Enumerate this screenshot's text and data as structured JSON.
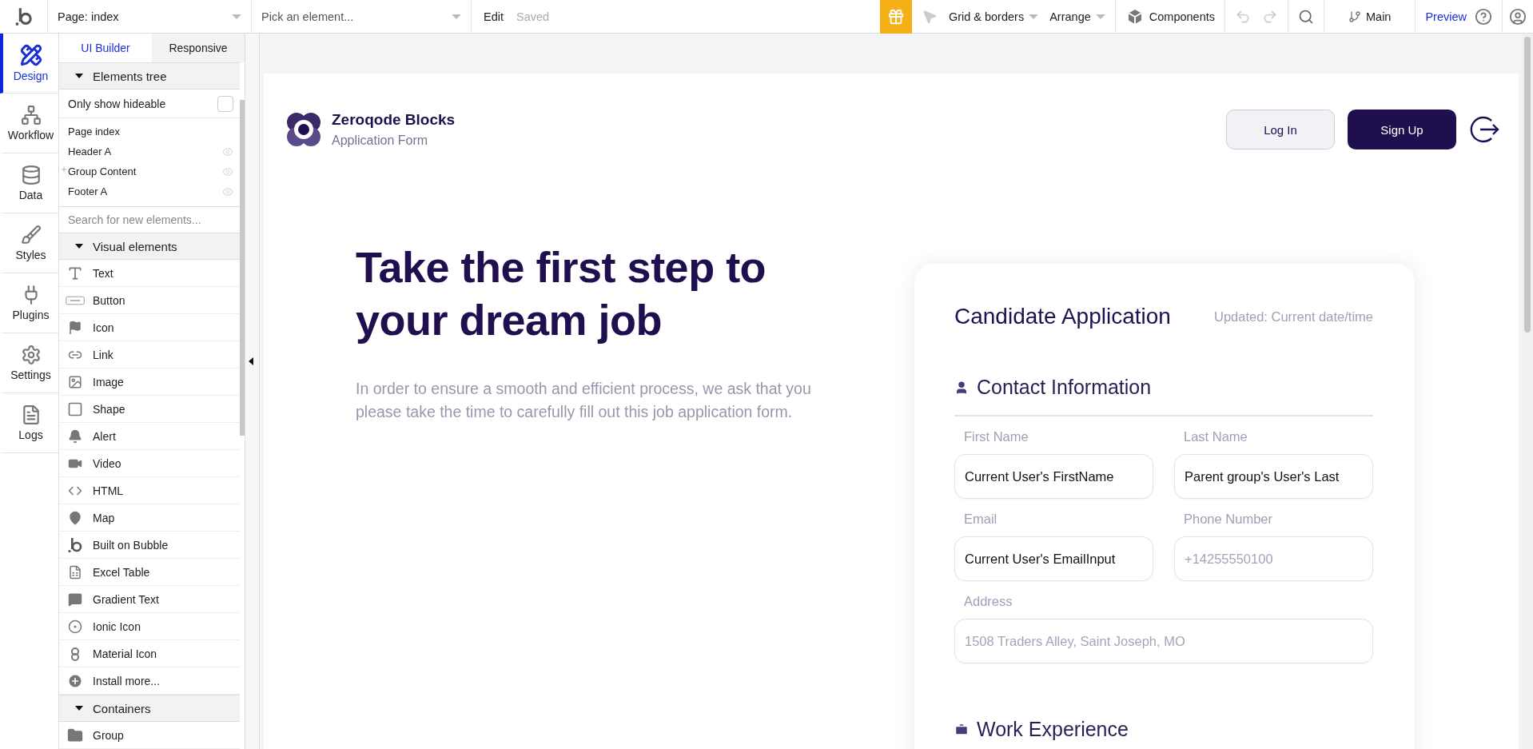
{
  "topbar": {
    "page_select": "Page: index",
    "element_select": {
      "placeholder": "Pick an element..."
    },
    "edit": "Edit",
    "status": "Saved",
    "grid": "Grid & borders",
    "arrange": "Arrange",
    "components": "Components",
    "branch": "Main",
    "preview": "Preview"
  },
  "nav": [
    {
      "label": "Design",
      "selected": true
    },
    {
      "label": "Workflow",
      "selected": false
    },
    {
      "label": "Data",
      "selected": false
    },
    {
      "label": "Styles",
      "selected": false
    },
    {
      "label": "Plugins",
      "selected": false
    },
    {
      "label": "Settings",
      "selected": false
    },
    {
      "label": "Logs",
      "selected": false
    }
  ],
  "panel_tabs": [
    {
      "label": "UI Builder",
      "selected": true
    },
    {
      "label": "Responsive",
      "selected": false
    }
  ],
  "elements_tree": {
    "title": "Elements tree",
    "expanded": true,
    "only_hideable": {
      "label": "Only show hideable",
      "checked": false
    },
    "items": [
      {
        "label": "Page index",
        "kind": "page"
      },
      {
        "label": "Header A",
        "kind": "element"
      },
      {
        "label": "Group Content",
        "kind": "group"
      },
      {
        "label": "Footer A",
        "kind": "element"
      }
    ]
  },
  "element_search": {
    "placeholder": "Search for new elements..."
  },
  "sections": [
    {
      "title": "Visual elements",
      "expanded": true,
      "items": [
        "Text",
        "Button",
        "Icon",
        "Link",
        "Image",
        "Shape",
        "Alert",
        "Video",
        "HTML",
        "Map",
        "Built on Bubble",
        "Excel Table",
        "Gradient Text",
        "Ionic Icon",
        "Material Icon",
        "Install more..."
      ]
    },
    {
      "title": "Containers",
      "expanded": true,
      "items": [
        "Group"
      ]
    }
  ],
  "page": {
    "brand": {
      "name": "Zeroqode Blocks",
      "subtitle": "Application Form"
    },
    "buttons": [
      {
        "label": "Log In",
        "kind": "secondary"
      },
      {
        "label": "Sign Up",
        "kind": "primary"
      }
    ],
    "hero": {
      "title": "Take the first step to your dream job",
      "text": "In order to ensure a smooth and efficient process, we ask that you please take the time to carefully fill out this job application form."
    },
    "card": {
      "title": "Candidate Application",
      "updated": "Updated: Current date/time",
      "sections": [
        {
          "title": "Contact Information",
          "kind": "contact",
          "fields": [
            {
              "label": "First Name",
              "value": "Current User's FirstName",
              "wide": false
            },
            {
              "label": "Last Name",
              "value": "Parent group's User's Last",
              "wide": false
            },
            {
              "label": "Email",
              "value": "Current User's EmailInput",
              "wide": false
            },
            {
              "label": "Phone Number",
              "placeholder": "+14255550100",
              "wide": false
            },
            {
              "label": "Address",
              "placeholder": "1508 Traders Alley, Saint Joseph, MO",
              "wide": true
            }
          ]
        },
        {
          "title": "Work Experience",
          "kind": "work"
        }
      ]
    }
  }
}
